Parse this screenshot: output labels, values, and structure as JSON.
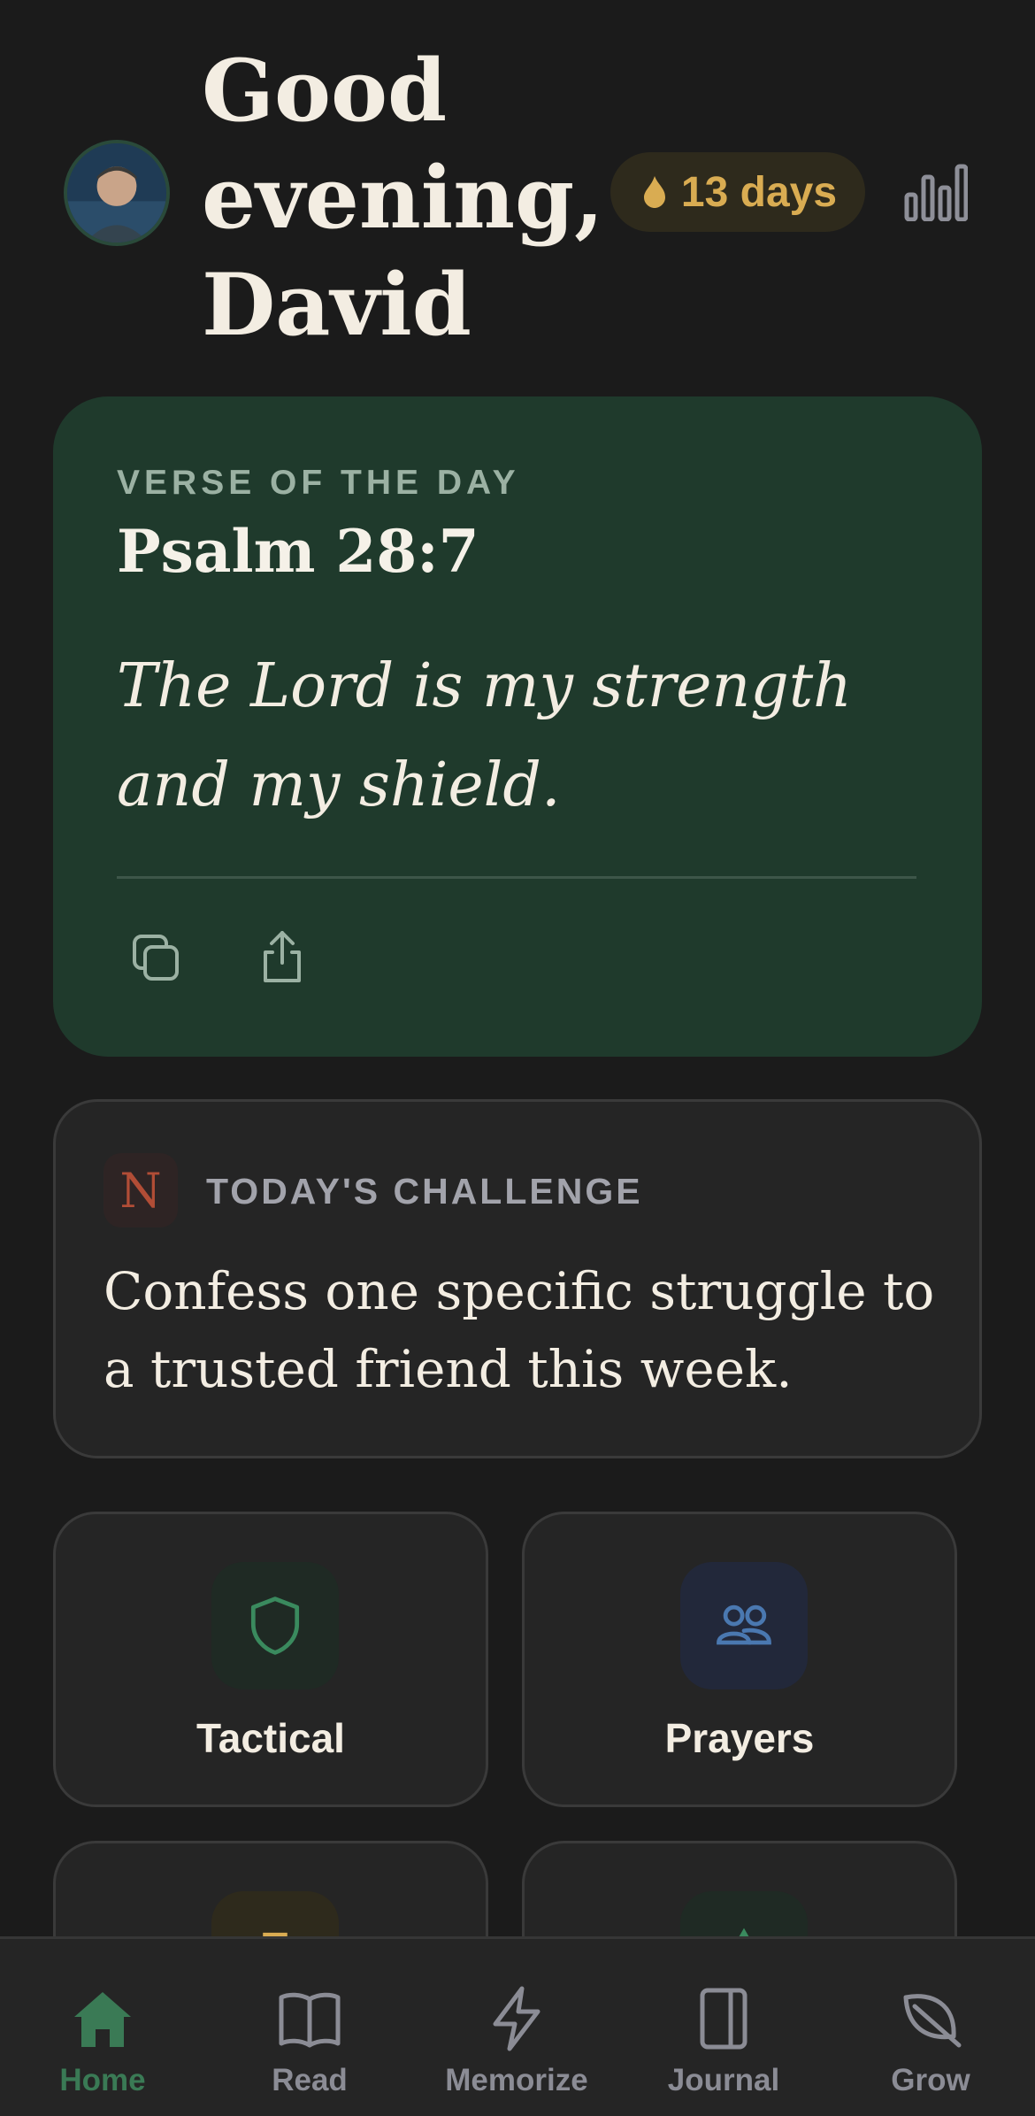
{
  "header": {
    "greeting": "Good evening, David",
    "streak_label": "13 days",
    "avatar": "user-avatar-photo"
  },
  "verse": {
    "eyebrow": "VERSE OF THE DAY",
    "reference": "Psalm 28:7",
    "text": "The Lord is my strength and my shield.",
    "actions": [
      "copy-icon",
      "share-icon"
    ]
  },
  "challenge": {
    "badge": "N",
    "eyebrow": "TODAY'S CHALLENGE",
    "text": "Confess one specific struggle to a trusted friend this week."
  },
  "tiles": [
    {
      "label": "Tactical",
      "icon": "shield-icon",
      "color": "#3a8a5e"
    },
    {
      "label": "Prayers",
      "icon": "people-icon",
      "color": "#4a78b0"
    },
    {
      "label": "",
      "icon": "briefcase-icon",
      "color": "#d9ac52"
    },
    {
      "label": "",
      "icon": "tree-icon",
      "color": "#3a8a5e"
    }
  ],
  "nav": {
    "items": [
      {
        "label": "Home",
        "icon": "home-icon",
        "active": true
      },
      {
        "label": "Read",
        "icon": "book-icon",
        "active": false
      },
      {
        "label": "Memorize",
        "icon": "lightning-icon",
        "active": false
      },
      {
        "label": "Journal",
        "icon": "journal-icon",
        "active": false
      },
      {
        "label": "Grow",
        "icon": "leaf-icon",
        "active": false
      }
    ]
  },
  "colors": {
    "background": "#1b1b1b",
    "verse_card": "#1f3a2c",
    "streak_accent": "#d9ac52",
    "active_tab": "#3a7a55"
  }
}
